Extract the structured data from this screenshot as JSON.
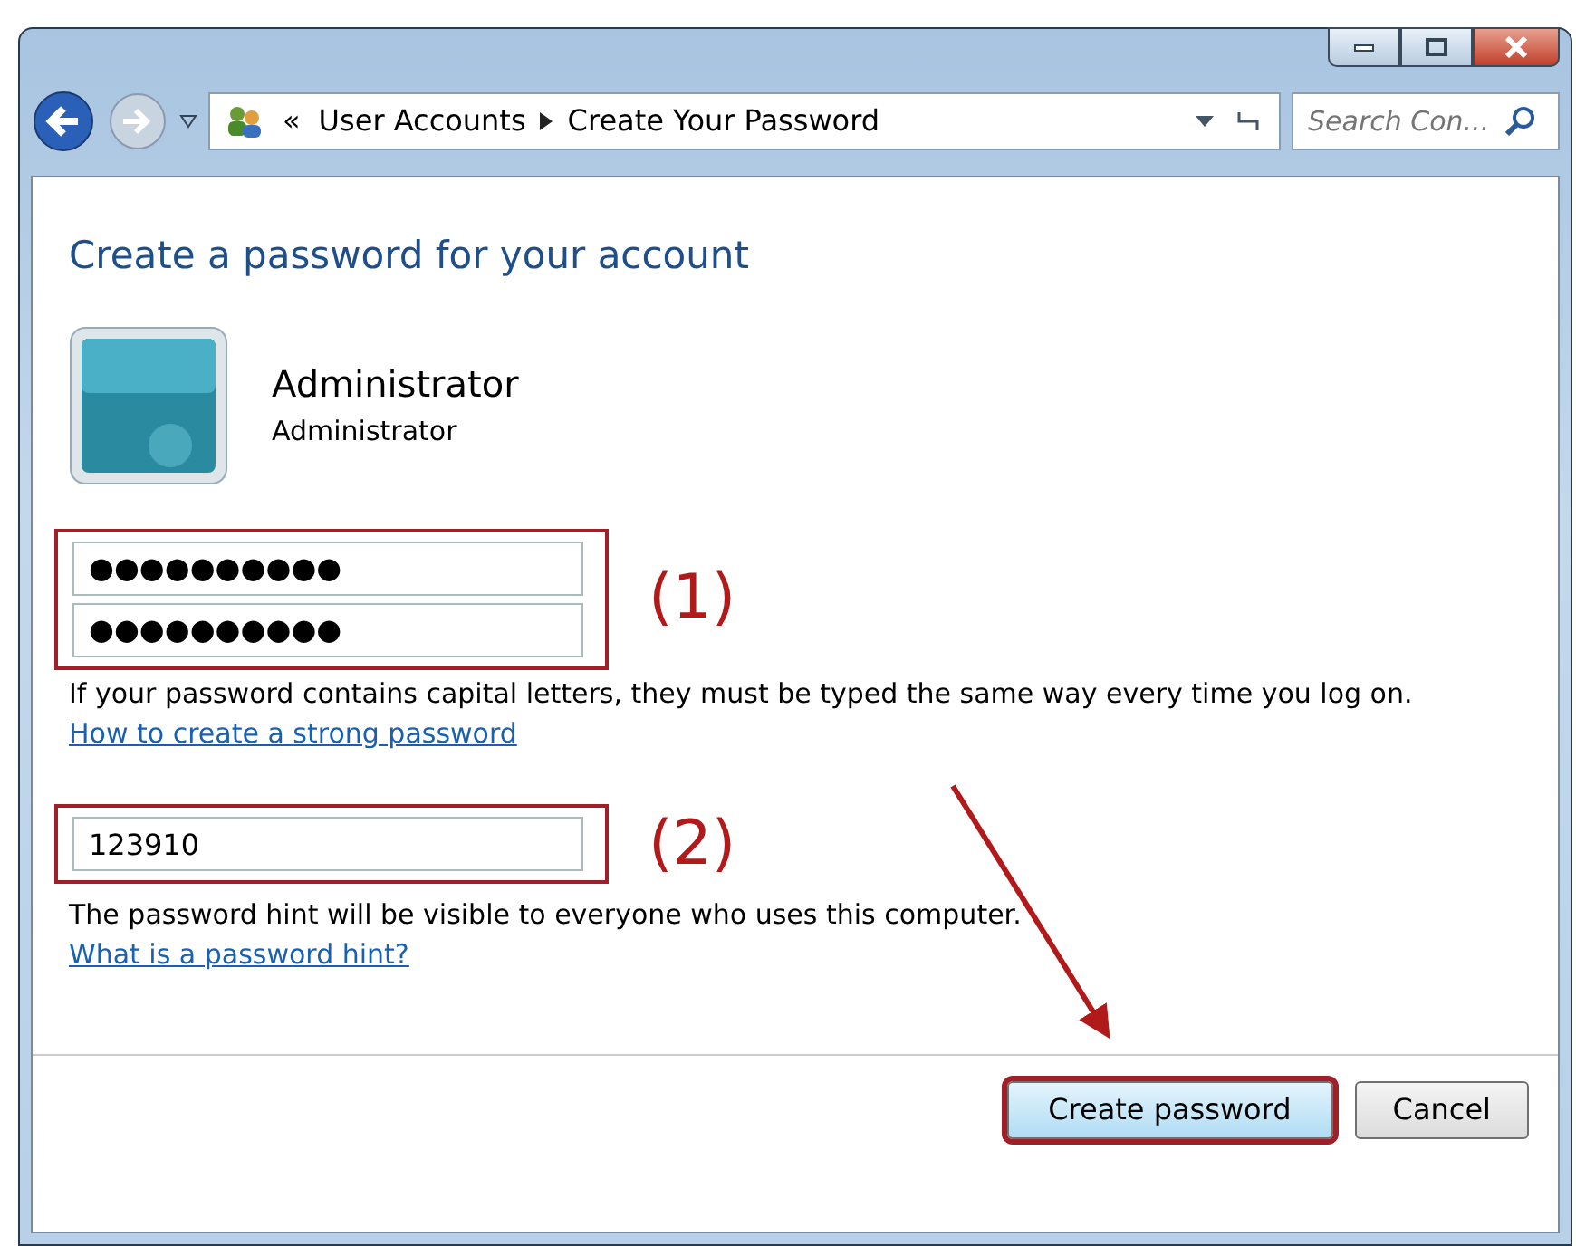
{
  "window": {
    "buttons": [
      {
        "kind": "minimize"
      },
      {
        "kind": "maximize"
      },
      {
        "kind": "close"
      }
    ]
  },
  "address_bar": {
    "overflow": "«",
    "crumbs": [
      "User Accounts",
      "Create Your Password"
    ]
  },
  "search": {
    "placeholder": "Search Con..."
  },
  "heading": "Create a password for your account",
  "account": {
    "name": "Administrator",
    "type": "Administrator"
  },
  "password_fields": [
    {
      "value": "●●●●●●●●●●"
    },
    {
      "value": "●●●●●●●●●●"
    }
  ],
  "annotations": [
    "(1)",
    "(2)"
  ],
  "capitals_note": "If your password contains capital letters, they must be typed the same way every time you log on.",
  "strong_link": "How to create a strong password",
  "hint_field": {
    "value": "123910"
  },
  "hint_note": "The password hint will be visible to everyone who uses this computer.",
  "hint_link": "What is a password hint?",
  "buttons": [
    {
      "label": "Create password",
      "highlighted": true
    },
    {
      "label": "Cancel",
      "highlighted": false
    }
  ]
}
